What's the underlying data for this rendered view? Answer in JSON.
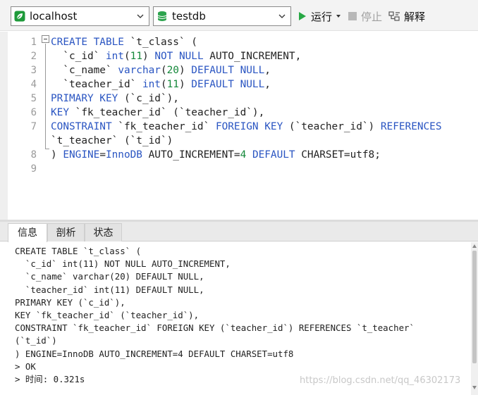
{
  "toolbar": {
    "connection": {
      "value": "localhost",
      "icon": "leaf-connection-icon",
      "icon_color": "#1e9a3a"
    },
    "database": {
      "value": "testdb",
      "icon": "database-icon",
      "icon_color": "#2da44e"
    },
    "run_label": "运行",
    "stop_label": "停止",
    "explain_label": "解释"
  },
  "editor": {
    "line_numbers": [
      "1",
      "2",
      "3",
      "4",
      "5",
      "6",
      "7",
      "",
      "8",
      "9"
    ],
    "lines": [
      [
        {
          "t": "CREATE TABLE",
          "c": "kw"
        },
        {
          "t": " `t_class` (",
          "c": "id"
        }
      ],
      [
        {
          "t": "  `c_id` ",
          "c": "id"
        },
        {
          "t": "int",
          "c": "kw"
        },
        {
          "t": "(",
          "c": "id"
        },
        {
          "t": "11",
          "c": "num"
        },
        {
          "t": ") ",
          "c": "id"
        },
        {
          "t": "NOT NULL",
          "c": "kw"
        },
        {
          "t": " AUTO_INCREMENT,",
          "c": "id"
        }
      ],
      [
        {
          "t": "  `c_name` ",
          "c": "id"
        },
        {
          "t": "varchar",
          "c": "kw"
        },
        {
          "t": "(",
          "c": "id"
        },
        {
          "t": "20",
          "c": "num"
        },
        {
          "t": ") ",
          "c": "id"
        },
        {
          "t": "DEFAULT NULL",
          "c": "kw"
        },
        {
          "t": ",",
          "c": "id"
        }
      ],
      [
        {
          "t": "  `teacher_id` ",
          "c": "id"
        },
        {
          "t": "int",
          "c": "kw"
        },
        {
          "t": "(",
          "c": "id"
        },
        {
          "t": "11",
          "c": "num"
        },
        {
          "t": ") ",
          "c": "id"
        },
        {
          "t": "DEFAULT NULL",
          "c": "kw"
        },
        {
          "t": ",",
          "c": "id"
        }
      ],
      [
        {
          "t": "PRIMARY KEY",
          "c": "kw"
        },
        {
          "t": " (`c_id`),",
          "c": "id"
        }
      ],
      [
        {
          "t": "KEY",
          "c": "kw"
        },
        {
          "t": " `fk_teacher_id` (`teacher_id`),",
          "c": "id"
        }
      ],
      [
        {
          "t": "CONSTRAINT",
          "c": "kw"
        },
        {
          "t": " `fk_teacher_id` ",
          "c": "id"
        },
        {
          "t": "FOREIGN KEY",
          "c": "kw"
        },
        {
          "t": " (`teacher_id`) ",
          "c": "id"
        },
        {
          "t": "REFERENCES",
          "c": "kw"
        }
      ],
      [
        {
          "t": "`t_teacher` (`t_id`)",
          "c": "id"
        }
      ],
      [
        {
          "t": ") ",
          "c": "id"
        },
        {
          "t": "ENGINE",
          "c": "kw"
        },
        {
          "t": "=",
          "c": "id"
        },
        {
          "t": "InnoDB",
          "c": "kw"
        },
        {
          "t": " AUTO_INCREMENT=",
          "c": "id"
        },
        {
          "t": "4",
          "c": "num"
        },
        {
          "t": " ",
          "c": "id"
        },
        {
          "t": "DEFAULT",
          "c": "kw"
        },
        {
          "t": " CHARSET=utf8;",
          "c": "id"
        }
      ],
      []
    ]
  },
  "results": {
    "tabs": [
      "信息",
      "剖析",
      "状态"
    ],
    "active_tab": "信息",
    "output_lines": [
      "CREATE TABLE `t_class` (",
      "  `c_id` int(11) NOT NULL AUTO_INCREMENT,",
      "  `c_name` varchar(20) DEFAULT NULL,",
      "  `teacher_id` int(11) DEFAULT NULL,",
      "PRIMARY KEY (`c_id`),",
      "KEY `fk_teacher_id` (`teacher_id`),",
      "CONSTRAINT `fk_teacher_id` FOREIGN KEY (`teacher_id`) REFERENCES `t_teacher`",
      "(`t_id`)",
      ") ENGINE=InnoDB AUTO_INCREMENT=4 DEFAULT CHARSET=utf8",
      "> OK",
      "> 时间: 0.321s"
    ]
  },
  "watermark": "https://blog.csdn.net/qq_46302173",
  "colors": {
    "keyword": "#2a55c2",
    "number": "#14883a",
    "run_icon": "#27a844"
  }
}
